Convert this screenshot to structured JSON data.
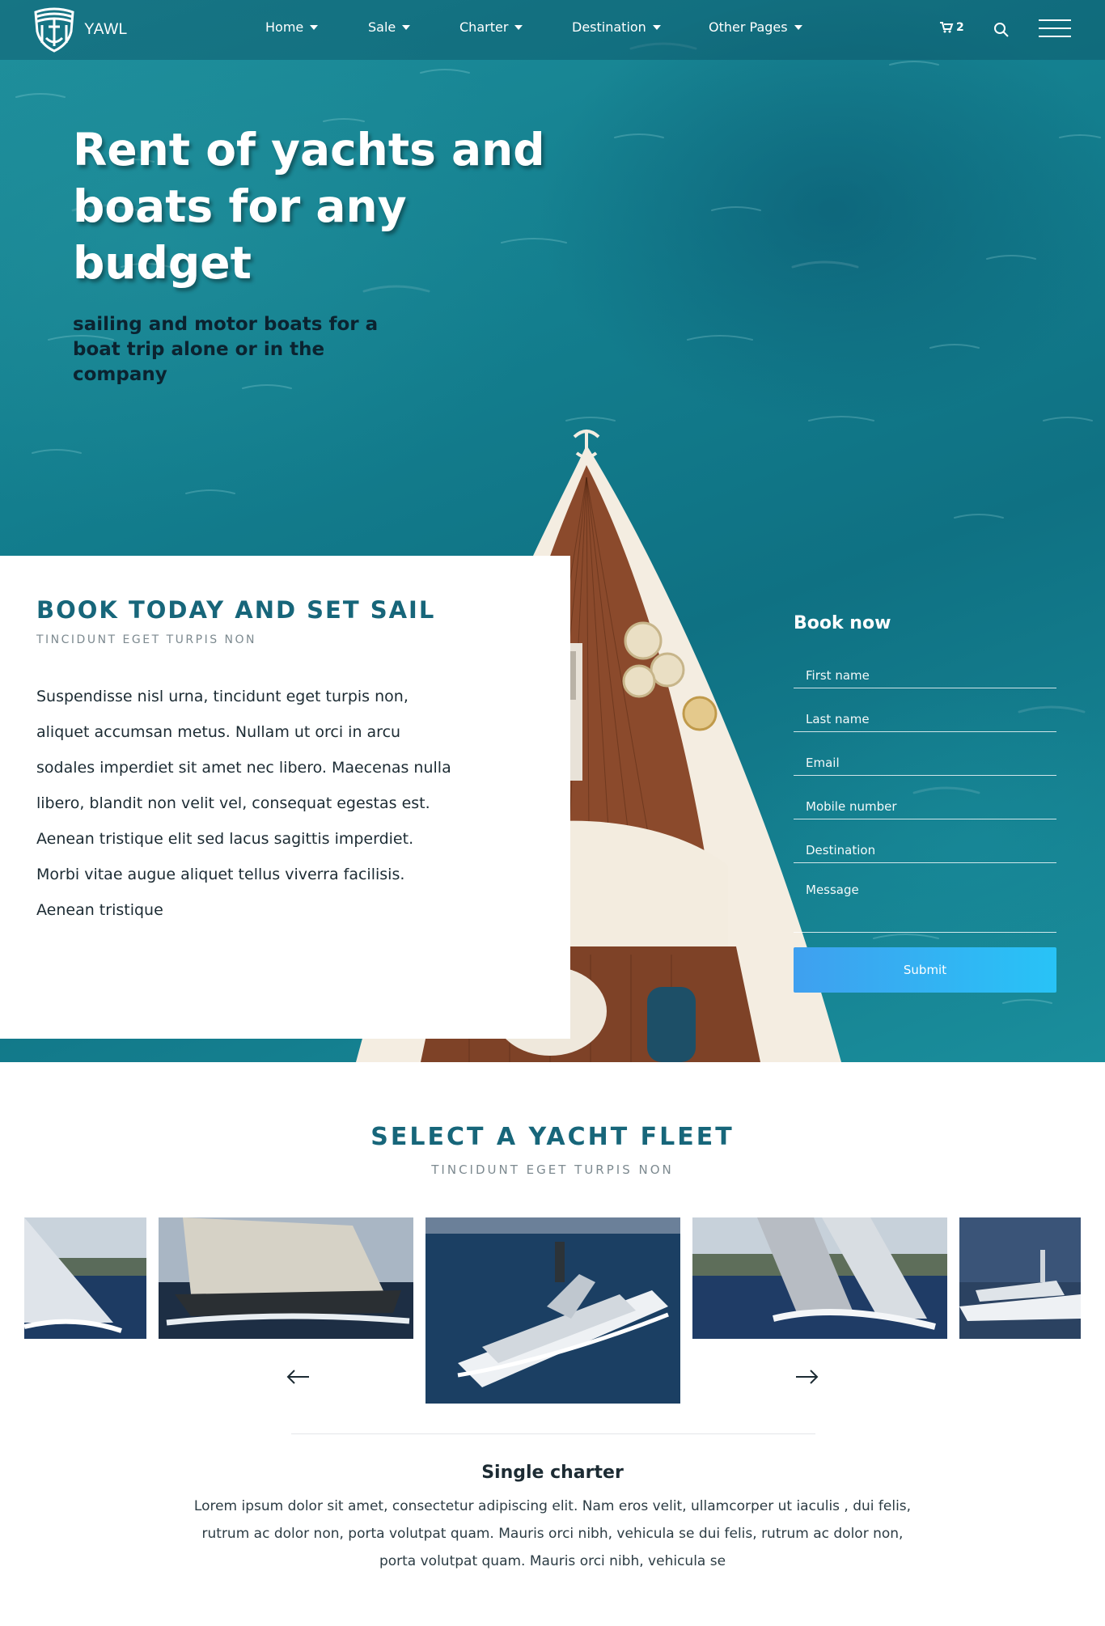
{
  "brand": {
    "name": "YAWL"
  },
  "nav": {
    "items": [
      {
        "label": "Home"
      },
      {
        "label": "Sale"
      },
      {
        "label": "Charter"
      },
      {
        "label": "Destination"
      },
      {
        "label": "Other Pages"
      }
    ],
    "cart_count": "2"
  },
  "hero": {
    "title": "Rent of yachts and boats for any budget",
    "subtitle": "sailing and motor boats for a boat trip alone or in the company"
  },
  "book_card": {
    "title": "BOOK TODAY AND SET SAIL",
    "subtitle": "TINCIDUNT EGET TURPIS NON",
    "text": "Suspendisse nisl urna, tincidunt eget turpis non, aliquet accumsan metus. Nullam ut orci in arcu sodales imperdiet sit amet nec libero. Maecenas nulla libero, blandit non velit vel, consequat egestas est. Aenean tristique elit sed lacus sagittis imperdiet. Morbi vitae augue aliquet tellus viverra facilisis.",
    "text2": "Aenean tristique"
  },
  "form": {
    "title": "Book now",
    "first_name": "First name",
    "last_name": "Last name",
    "email": "Email",
    "mobile": "Mobile number",
    "destination": "Destination",
    "message": "Message",
    "submit": "Submit"
  },
  "fleet": {
    "title": "SELECT A YACHT FLEET",
    "subtitle": "TINCIDUNT EGET TURPIS NON",
    "charter_title": "Single charter",
    "charter_text": "Lorem ipsum dolor sit amet, consectetur adipiscing elit. Nam eros velit, ullamcorper ut iaculis , dui felis, rutrum ac dolor non, porta volutpat quam. Mauris orci nibh, vehicula se dui felis, rutrum ac dolor non, porta volutpat quam. Mauris orci nibh, vehicula se"
  },
  "colors": {
    "accent": "#17667a",
    "sea": "#137e8e",
    "button_start": "#3fa0ef",
    "button_end": "#28c3f6"
  },
  "icons": [
    "anchor-shield-logo-icon",
    "cart-icon",
    "search-icon",
    "menu-icon",
    "arrow-left-icon",
    "arrow-right-icon"
  ]
}
